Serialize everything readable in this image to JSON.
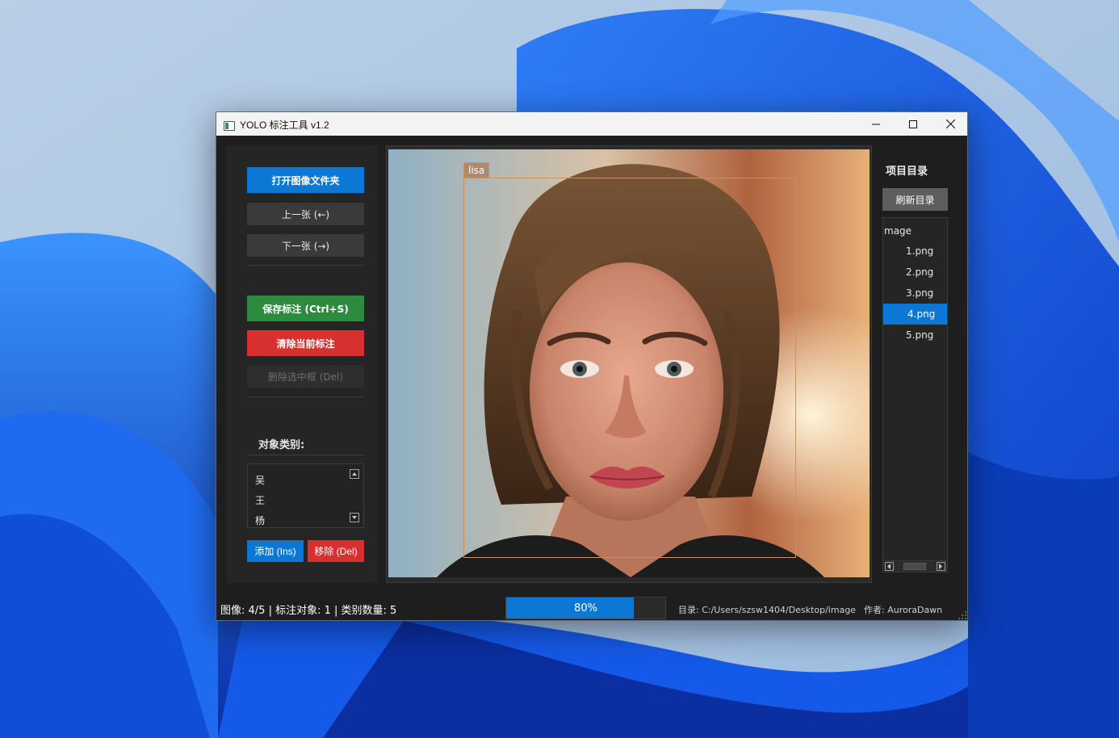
{
  "window": {
    "title": "YOLO 标注工具 v1.2"
  },
  "left_panel": {
    "open_folder": "打开图像文件夹",
    "prev": "上一张 (←)",
    "next": "下一张 (→)",
    "save": "保存标注 (Ctrl+S)",
    "clear": "清除当前标注",
    "delete_box": "删除选中框 (Del)",
    "class_label": "对象类别:",
    "classes": [
      "吴",
      "王",
      "杨"
    ],
    "add": "添加 (Ins)",
    "remove": "移除 (Del)"
  },
  "canvas": {
    "bbox_label": "lisa"
  },
  "right_panel": {
    "title": "项目目录",
    "refresh": "刷新目录",
    "root": "mage",
    "files": [
      "1.png",
      "2.png",
      "3.png",
      "4.png",
      "5.png"
    ],
    "selected_index": 3
  },
  "status": {
    "text": "图像: 4/5  |  标注对象: 1  |  类别数量: 5",
    "progress_label": "80%",
    "progress_value": 0.8,
    "directory": "目录: C:/Users/szsw1404/Desktop/image",
    "author": "作者: AuroraDawn"
  },
  "colors": {
    "accent": "#0a78d4",
    "save": "#2e8b3e",
    "danger": "#d63031",
    "bbox": "#c9935d"
  }
}
